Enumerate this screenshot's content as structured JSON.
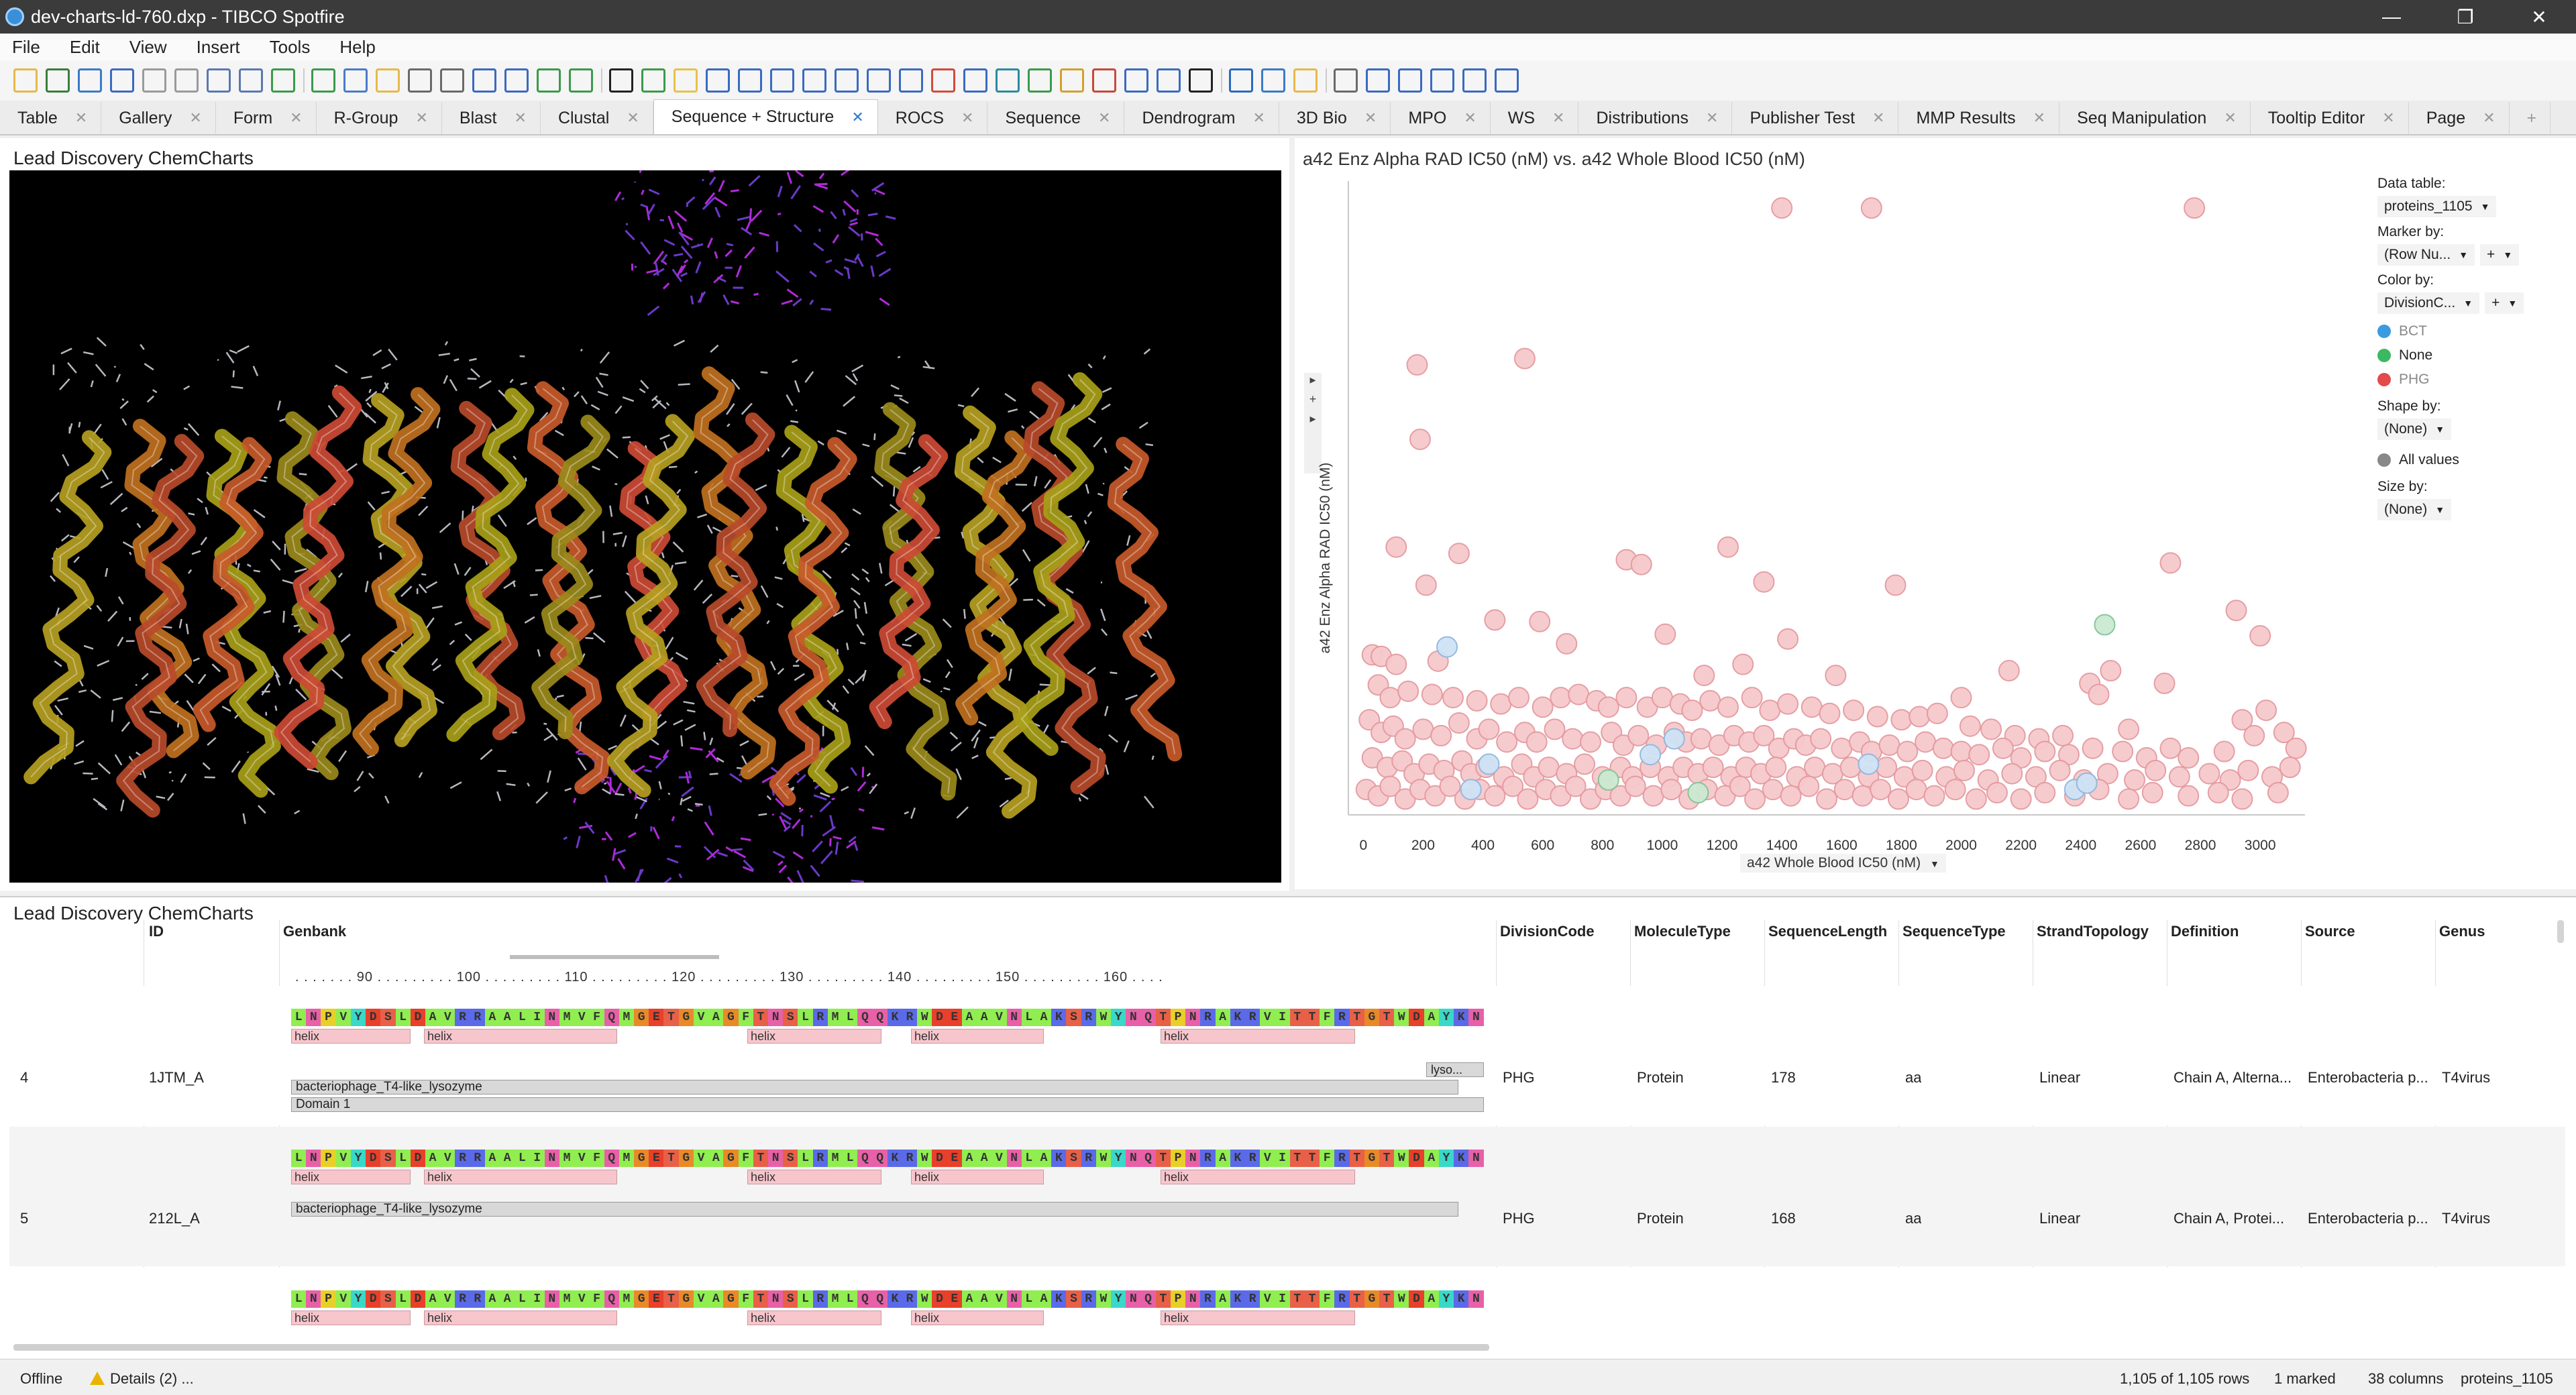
{
  "window": {
    "title": "dev-charts-ld-760.dxp - TIBCO Spotfire"
  },
  "menu": [
    "File",
    "Edit",
    "View",
    "Insert",
    "Tools",
    "Help"
  ],
  "tabs": [
    {
      "label": "Table"
    },
    {
      "label": "Gallery"
    },
    {
      "label": "Form"
    },
    {
      "label": "R-Group"
    },
    {
      "label": "Blast"
    },
    {
      "label": "Clustal"
    },
    {
      "label": "Sequence + Structure",
      "active": true
    },
    {
      "label": "ROCS"
    },
    {
      "label": "Sequence"
    },
    {
      "label": "Dendrogram"
    },
    {
      "label": "3D Bio"
    },
    {
      "label": "MPO"
    },
    {
      "label": "WS"
    },
    {
      "label": "Distributions"
    },
    {
      "label": "Publisher Test"
    },
    {
      "label": "MMP Results"
    },
    {
      "label": "Seq Manipulation"
    },
    {
      "label": "Tooltip Editor"
    },
    {
      "label": "Page"
    }
  ],
  "viewer": {
    "title": "Lead Discovery ChemCharts"
  },
  "scatter": {
    "title": "a42 Enz Alpha RAD IC50 (nM) vs. a42 Whole Blood IC50 (nM)",
    "xaxis_label": "a42 Whole Blood IC50 (nM)",
    "yaxis_label": "a42 Enz Alpha RAD IC50 (nM)"
  },
  "legend": {
    "data_table_label": "Data table:",
    "data_table_value": "proteins_1105",
    "marker_by_label": "Marker by:",
    "marker_by_value": "(Row Nu...",
    "color_by_label": "Color by:",
    "color_by_value": "DivisionC...",
    "color_entries": [
      {
        "label": "BCT",
        "color": "#3b9ae0"
      },
      {
        "label": "None",
        "color": "#3cb862"
      },
      {
        "label": "PHG",
        "color": "#e34a4a"
      }
    ],
    "shape_by_label": "Shape by:",
    "shape_by_value": "(None)",
    "shape_entry": "All values",
    "size_by_label": "Size by:",
    "size_by_value": "(None)"
  },
  "chart_data": {
    "type": "scatter",
    "title": "a42 Enz Alpha RAD IC50 (nM) vs. a42 Whole Blood IC50 (nM)",
    "xlabel": "a42 Whole Blood IC50 (nM)",
    "ylabel": "a42 Enz Alpha RAD IC50 (nM)",
    "xlim": [
      -50,
      3150
    ],
    "ylim": [
      0,
      2000
    ],
    "x_ticks": [
      0,
      200,
      400,
      600,
      800,
      1000,
      1200,
      1400,
      1600,
      1800,
      2000,
      2200,
      2400,
      2600,
      2800,
      3000
    ],
    "x_tick_labels": [
      "0",
      "200",
      "400",
      "600",
      "800",
      "1000",
      "1200",
      "1400",
      "1600",
      "1800",
      "2000",
      "2200",
      "2400",
      "2600",
      "2800",
      "3000"
    ],
    "series": [
      {
        "name": "PHG",
        "color": "#f6c9cc",
        "stroke": "#e49aa0",
        "points": [
          [
            1400,
            1915
          ],
          [
            1700,
            1915
          ],
          [
            2780,
            1915
          ],
          [
            180,
            1420
          ],
          [
            540,
            1440
          ],
          [
            190,
            1185
          ],
          [
            110,
            845
          ],
          [
            320,
            825
          ],
          [
            880,
            805
          ],
          [
            930,
            790
          ],
          [
            1220,
            845
          ],
          [
            1340,
            735
          ],
          [
            1780,
            725
          ],
          [
            2700,
            795
          ],
          [
            210,
            725
          ],
          [
            440,
            615
          ],
          [
            590,
            610
          ],
          [
            1010,
            570
          ],
          [
            1420,
            555
          ],
          [
            2920,
            645
          ],
          [
            3000,
            565
          ],
          [
            30,
            505
          ],
          [
            60,
            500
          ],
          [
            110,
            475
          ],
          [
            250,
            485
          ],
          [
            680,
            540
          ],
          [
            1270,
            475
          ],
          [
            1140,
            440
          ],
          [
            1580,
            440
          ],
          [
            2160,
            455
          ],
          [
            2500,
            455
          ],
          [
            2680,
            415
          ],
          [
            2430,
            415
          ],
          [
            2460,
            380
          ],
          [
            2000,
            370
          ],
          [
            50,
            410
          ],
          [
            90,
            370
          ],
          [
            150,
            390
          ],
          [
            230,
            380
          ],
          [
            300,
            370
          ],
          [
            380,
            360
          ],
          [
            460,
            350
          ],
          [
            520,
            370
          ],
          [
            600,
            340
          ],
          [
            660,
            370
          ],
          [
            720,
            380
          ],
          [
            780,
            360
          ],
          [
            820,
            340
          ],
          [
            880,
            370
          ],
          [
            950,
            340
          ],
          [
            1000,
            370
          ],
          [
            1060,
            350
          ],
          [
            1100,
            330
          ],
          [
            1160,
            360
          ],
          [
            1220,
            340
          ],
          [
            1300,
            370
          ],
          [
            1360,
            330
          ],
          [
            1420,
            350
          ],
          [
            1500,
            340
          ],
          [
            1560,
            320
          ],
          [
            1640,
            330
          ],
          [
            1720,
            310
          ],
          [
            1800,
            300
          ],
          [
            1860,
            310
          ],
          [
            1920,
            320
          ],
          [
            2030,
            280
          ],
          [
            2100,
            270
          ],
          [
            2180,
            250
          ],
          [
            2260,
            240
          ],
          [
            2340,
            250
          ],
          [
            2560,
            270
          ],
          [
            2940,
            300
          ],
          [
            3020,
            330
          ],
          [
            2980,
            250
          ],
          [
            20,
            300
          ],
          [
            60,
            260
          ],
          [
            100,
            280
          ],
          [
            140,
            240
          ],
          [
            200,
            270
          ],
          [
            260,
            250
          ],
          [
            320,
            290
          ],
          [
            380,
            240
          ],
          [
            420,
            270
          ],
          [
            480,
            230
          ],
          [
            540,
            260
          ],
          [
            580,
            230
          ],
          [
            640,
            270
          ],
          [
            700,
            240
          ],
          [
            760,
            230
          ],
          [
            830,
            260
          ],
          [
            870,
            220
          ],
          [
            920,
            250
          ],
          [
            980,
            220
          ],
          [
            1040,
            260
          ],
          [
            1080,
            230
          ],
          [
            1130,
            240
          ],
          [
            1190,
            220
          ],
          [
            1240,
            250
          ],
          [
            1290,
            230
          ],
          [
            1340,
            250
          ],
          [
            1390,
            210
          ],
          [
            1440,
            240
          ],
          [
            1480,
            220
          ],
          [
            1530,
            240
          ],
          [
            1600,
            210
          ],
          [
            1660,
            230
          ],
          [
            1700,
            200
          ],
          [
            1760,
            220
          ],
          [
            1820,
            200
          ],
          [
            1880,
            230
          ],
          [
            1940,
            210
          ],
          [
            2000,
            200
          ],
          [
            2060,
            190
          ],
          [
            2140,
            210
          ],
          [
            2200,
            180
          ],
          [
            2280,
            200
          ],
          [
            2360,
            190
          ],
          [
            2440,
            210
          ],
          [
            2540,
            200
          ],
          [
            2620,
            180
          ],
          [
            2700,
            210
          ],
          [
            2760,
            180
          ],
          [
            2880,
            200
          ],
          [
            3080,
            260
          ],
          [
            3120,
            210
          ],
          [
            30,
            180
          ],
          [
            80,
            150
          ],
          [
            130,
            170
          ],
          [
            170,
            130
          ],
          [
            220,
            160
          ],
          [
            270,
            140
          ],
          [
            330,
            170
          ],
          [
            360,
            130
          ],
          [
            410,
            150
          ],
          [
            470,
            120
          ],
          [
            530,
            160
          ],
          [
            570,
            120
          ],
          [
            620,
            150
          ],
          [
            680,
            130
          ],
          [
            740,
            160
          ],
          [
            800,
            120
          ],
          [
            860,
            150
          ],
          [
            900,
            120
          ],
          [
            960,
            150
          ],
          [
            1020,
            120
          ],
          [
            1070,
            150
          ],
          [
            1120,
            130
          ],
          [
            1170,
            150
          ],
          [
            1230,
            120
          ],
          [
            1280,
            150
          ],
          [
            1330,
            130
          ],
          [
            1380,
            150
          ],
          [
            1450,
            120
          ],
          [
            1510,
            150
          ],
          [
            1570,
            130
          ],
          [
            1630,
            150
          ],
          [
            1690,
            120
          ],
          [
            1750,
            150
          ],
          [
            1810,
            120
          ],
          [
            1870,
            140
          ],
          [
            1950,
            120
          ],
          [
            2010,
            140
          ],
          [
            2090,
            110
          ],
          [
            2170,
            130
          ],
          [
            2250,
            120
          ],
          [
            2330,
            140
          ],
          [
            2410,
            110
          ],
          [
            2490,
            130
          ],
          [
            2580,
            110
          ],
          [
            2650,
            140
          ],
          [
            2730,
            120
          ],
          [
            2830,
            130
          ],
          [
            2900,
            110
          ],
          [
            2960,
            140
          ],
          [
            3040,
            120
          ],
          [
            3100,
            150
          ],
          [
            10,
            80
          ],
          [
            50,
            60
          ],
          [
            90,
            90
          ],
          [
            140,
            50
          ],
          [
            190,
            80
          ],
          [
            240,
            60
          ],
          [
            290,
            90
          ],
          [
            340,
            50
          ],
          [
            390,
            80
          ],
          [
            440,
            60
          ],
          [
            500,
            90
          ],
          [
            550,
            50
          ],
          [
            610,
            80
          ],
          [
            660,
            60
          ],
          [
            710,
            90
          ],
          [
            760,
            50
          ],
          [
            810,
            80
          ],
          [
            860,
            60
          ],
          [
            910,
            90
          ],
          [
            970,
            60
          ],
          [
            1030,
            80
          ],
          [
            1090,
            50
          ],
          [
            1150,
            80
          ],
          [
            1210,
            60
          ],
          [
            1260,
            90
          ],
          [
            1310,
            50
          ],
          [
            1370,
            80
          ],
          [
            1430,
            60
          ],
          [
            1490,
            90
          ],
          [
            1550,
            50
          ],
          [
            1610,
            80
          ],
          [
            1670,
            60
          ],
          [
            1730,
            80
          ],
          [
            1790,
            50
          ],
          [
            1850,
            80
          ],
          [
            1910,
            60
          ],
          [
            1980,
            80
          ],
          [
            2050,
            50
          ],
          [
            2120,
            70
          ],
          [
            2200,
            50
          ],
          [
            2280,
            70
          ],
          [
            2380,
            60
          ],
          [
            2460,
            80
          ],
          [
            2560,
            50
          ],
          [
            2640,
            70
          ],
          [
            2760,
            60
          ],
          [
            2860,
            70
          ],
          [
            2940,
            50
          ],
          [
            3060,
            70
          ]
        ]
      },
      {
        "name": "BCT",
        "color": "#cfe3f5",
        "stroke": "#8fb8de",
        "points": [
          [
            280,
            530
          ],
          [
            420,
            160
          ],
          [
            360,
            80
          ],
          [
            960,
            190
          ],
          [
            1040,
            240
          ],
          [
            1690,
            160
          ],
          [
            2380,
            80
          ],
          [
            2420,
            100
          ]
        ]
      },
      {
        "name": "None",
        "color": "#cbe9d2",
        "stroke": "#82c596",
        "points": [
          [
            2480,
            600
          ],
          [
            820,
            110
          ],
          [
            1120,
            70
          ]
        ]
      }
    ]
  },
  "table": {
    "title": "Lead Discovery ChemCharts",
    "columns": [
      "ID",
      "Genbank",
      "DivisionCode",
      "MoleculeType",
      "SequenceLength",
      "SequenceType",
      "StrandTopology",
      "Definition",
      "Source",
      "Genus"
    ],
    "ruler": {
      "prefix": ". . . . . . . 90 . . . . . . . . . 100 . . . . . . . . . 110 . . . . . . . . . 120 . . . . . . . . . 130 . . . . . . . . . 140 . . . . . . . . . 150 . . . . . . . . . 160 . . . ."
    },
    "sequence": "LNPVYDSLDAVRRAALINMVFQMGETGVAGFTNSLRMLQQKRWDEAAVNLAKSRWYNQTPNRAKRVITTFRTGTWDAYKN",
    "helix_label": "helix",
    "rows": [
      {
        "row": "4",
        "id": "1JTM_A",
        "divcode": "PHG",
        "moltype": "Protein",
        "seqlen": "178",
        "seqtype": "aa",
        "strand": "Linear",
        "definition": "Chain A, Alterna...",
        "source": "Enterobacteria p...",
        "genus": "T4virus",
        "annot1": "bacteriophage_T4-like_lysozyme",
        "annot2": "Domain 1",
        "annot3": "lyso..."
      },
      {
        "row": "5",
        "id": "212L_A",
        "divcode": "PHG",
        "moltype": "Protein",
        "seqlen": "168",
        "seqtype": "aa",
        "strand": "Linear",
        "definition": "Chain A, Protei...",
        "source": "Enterobacteria p...",
        "genus": "T4virus",
        "annot1": "bacteriophage_T4-like_lysozyme"
      }
    ]
  },
  "status": {
    "offline": "Offline",
    "details": "Details (2) ...",
    "rows": "1,105 of 1,105 rows",
    "marked": "1 marked",
    "columns": "38 columns",
    "table": "proteins_1105"
  }
}
